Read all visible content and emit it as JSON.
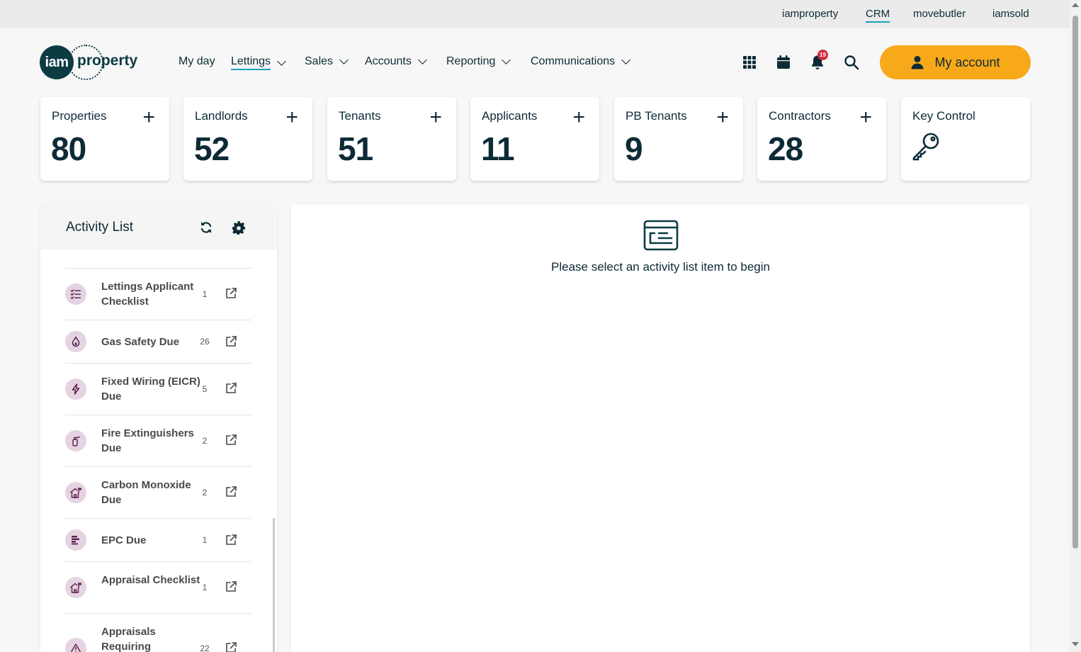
{
  "topbar": {
    "links": [
      "iamproperty",
      "CRM",
      "movebutler",
      "iamsold"
    ],
    "active": "CRM"
  },
  "brand": {
    "circle_text": "iam",
    "word": "property"
  },
  "nav": {
    "items": [
      "My day",
      "Lettings",
      "Sales",
      "Accounts",
      "Reporting",
      "Communications"
    ],
    "active": "Lettings"
  },
  "header_icons": [
    "apps-grid-icon",
    "calendar-icon",
    "bell-icon",
    "search-icon"
  ],
  "notifications": {
    "count": "19"
  },
  "account": {
    "label": "My account",
    "icon": "user-icon"
  },
  "colors": {
    "accent": "#f8a91a",
    "brand_dark": "#0d3b44",
    "link_underline": "#1aa3b8",
    "badge": "#d62b3c",
    "activity_icon_bg": "#e5d3e2"
  },
  "stats": [
    {
      "label": "Properties",
      "value": "80"
    },
    {
      "label": "Landlords",
      "value": "52"
    },
    {
      "label": "Tenants",
      "value": "51"
    },
    {
      "label": "Applicants",
      "value": "11"
    },
    {
      "label": "PB Tenants",
      "value": "9"
    },
    {
      "label": "Contractors",
      "value": "28"
    },
    {
      "label": "Key Control",
      "icon": "key-icon"
    }
  ],
  "activity": {
    "title": "Activity List",
    "items": [
      {
        "label": "Lettings Applicant Checklist",
        "count": "1",
        "icon": "checklist-icon"
      },
      {
        "label": "Gas Safety Due",
        "count": "26",
        "icon": "flame-icon"
      },
      {
        "label": "Fixed Wiring (EICR) Due",
        "count": "5",
        "icon": "lightning-icon"
      },
      {
        "label": "Fire Extinguishers Due",
        "count": "2",
        "icon": "extinguisher-icon"
      },
      {
        "label": "Carbon Monoxide Due",
        "count": "2",
        "icon": "house-flag-icon"
      },
      {
        "label": "EPC Due",
        "count": "1",
        "icon": "epc-bars-icon"
      },
      {
        "label": "Appraisal Checklist",
        "count": "1",
        "icon": "house-flag-icon"
      },
      {
        "label": "Appraisals Requiring",
        "count": "22",
        "icon": "warning-icon"
      }
    ]
  },
  "main": {
    "empty_message": "Please select an activity list item to begin",
    "icon": "list-card-icon"
  }
}
